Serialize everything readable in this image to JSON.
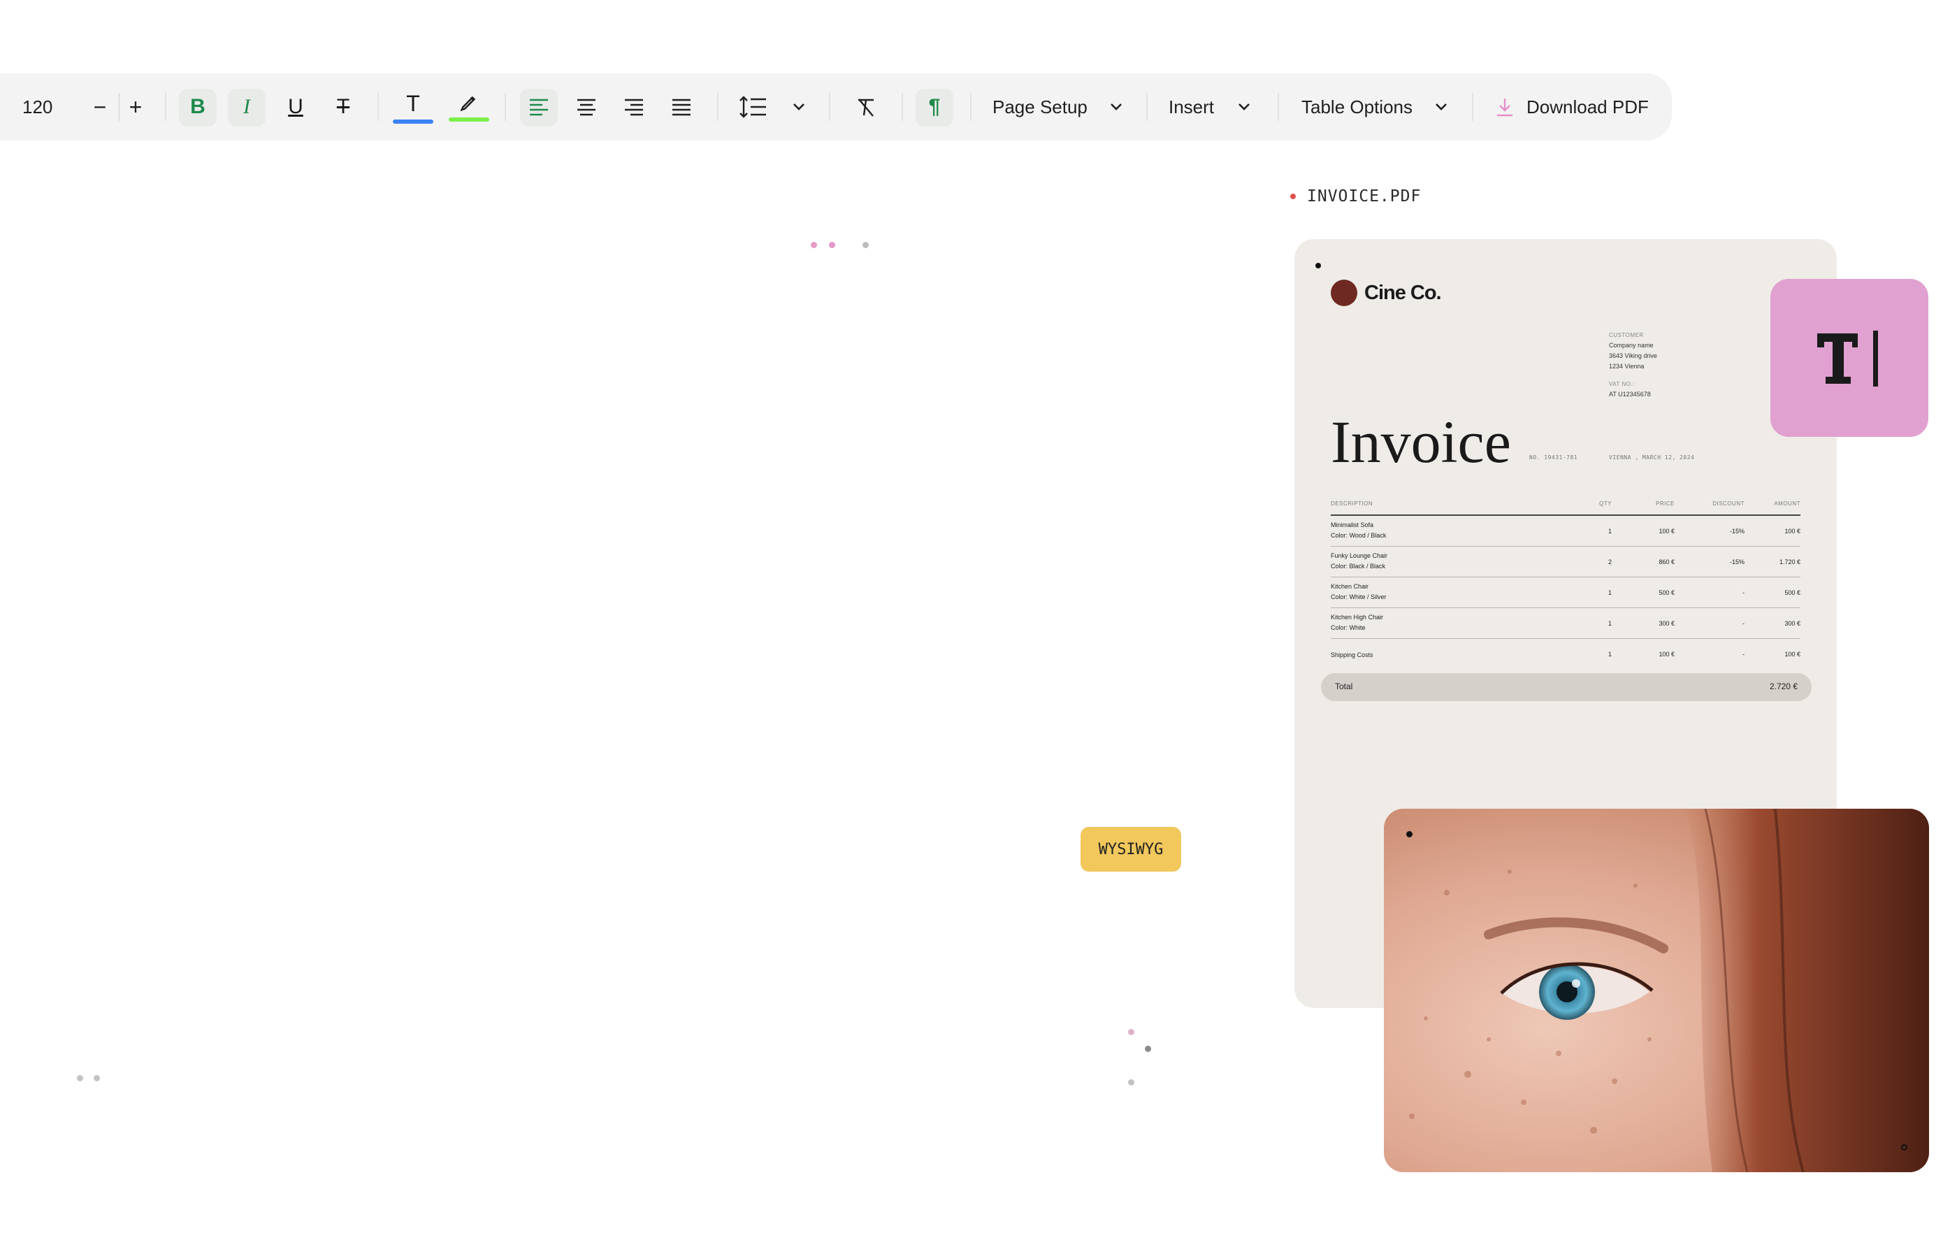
{
  "toolbar": {
    "font_size": "120",
    "minus": "−",
    "plus": "+",
    "bold": "B",
    "italic": "I",
    "underline": "U",
    "strike": "T",
    "text_color_glyph": "T",
    "text_color": "#3b82f6",
    "highlight_color": "#7cf04a",
    "page_setup": "Page Setup",
    "insert": "Insert",
    "table_options": "Table Options",
    "download_pdf": "Download PDF"
  },
  "file_label": "INVOICE.PDF",
  "invoice": {
    "brand": "Cine Co.",
    "customer_label": "CUSTOMER",
    "customer_name": "Company name",
    "address1": "3643 Viking drive",
    "address2": "1234 Vienna",
    "vat_label": "VAT NO.:",
    "vat_no": "AT U12345678",
    "title": "Invoice",
    "number": "NO. 19431-781",
    "place_date": "VIENNA , MARCH 12, 2024",
    "headers": [
      "DESCRIPTION",
      "QTY",
      "PRICE",
      "DISCOUNT",
      "AMOUNT"
    ],
    "rows": [
      {
        "name": "Minimalist Sofa",
        "detail": "Color: Wood / Black",
        "qty": "1",
        "price": "100 €",
        "discount": "-15%",
        "amount": "100 €"
      },
      {
        "name": "Funky Lounge Chair",
        "detail": "Color: Black / Black",
        "qty": "2",
        "price": "860 €",
        "discount": "-15%",
        "amount": "1.720 €"
      },
      {
        "name": "Kitchen Chair",
        "detail": "Color: White / Silver",
        "qty": "1",
        "price": "500 €",
        "discount": "-",
        "amount": "500 €"
      },
      {
        "name": "Kitchen High Chair",
        "detail": "Color: White",
        "qty": "1",
        "price": "300 €",
        "discount": "-",
        "amount": "300 €"
      },
      {
        "name": "Shipping Costs",
        "detail": "",
        "qty": "1",
        "price": "100 €",
        "discount": "-",
        "amount": "100 €"
      }
    ],
    "total_label": "Total",
    "total_value": "2.720 €"
  },
  "badge": "WYSIWYG",
  "colors": {
    "accent_green": "#1f8a4c",
    "pink_card": "#e0a1d0",
    "badge_yellow": "#f2c75c",
    "invoice_bg": "#efece8"
  },
  "icons": [
    "minus-icon",
    "plus-icon",
    "bold-icon",
    "italic-icon",
    "underline-icon",
    "strikethrough-icon",
    "text-color-icon",
    "highlighter-icon",
    "align-left-icon",
    "align-center-icon",
    "align-right-icon",
    "align-justify-icon",
    "line-height-icon",
    "clear-format-icon",
    "pilcrow-icon",
    "chevron-down-icon",
    "download-icon",
    "text-cursor-icon"
  ]
}
